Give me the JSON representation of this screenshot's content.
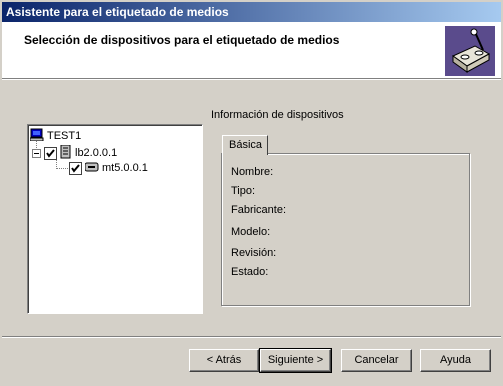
{
  "window": {
    "title": "Asistente para el etiquetado de medios"
  },
  "header": {
    "title": "Selección de dispositivos para el etiquetado de medios",
    "icon": "media-label-icon"
  },
  "tree": {
    "root": {
      "label": "TEST1",
      "icon": "computer-icon"
    },
    "library": {
      "label": "lb2.0.0.1",
      "icon": "tape-library-icon",
      "checked": true,
      "expanded": true
    },
    "drive": {
      "label": "mt5.0.0.1",
      "icon": "tape-drive-icon",
      "checked": true
    }
  },
  "info": {
    "title": "Información de dispositivos",
    "tab_label": "Básica",
    "fields": {
      "name": "Nombre:",
      "type": "Tipo:",
      "manufacturer": "Fabricante:",
      "model": "Modelo:",
      "revision": "Revisión:",
      "status": "Estado:"
    }
  },
  "buttons": {
    "back": "< Atrás",
    "next": "Siguiente >",
    "cancel": "Cancelar",
    "help": "Ayuda"
  }
}
